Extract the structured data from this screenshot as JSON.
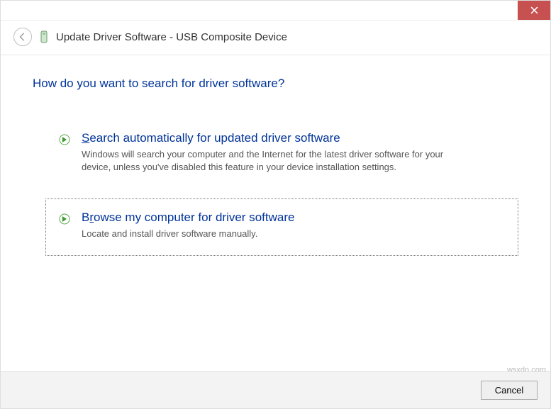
{
  "titlebar": {
    "close_tooltip": "Close"
  },
  "header": {
    "title": "Update Driver Software - USB Composite Device"
  },
  "main": {
    "question": "How do you want to search for driver software?",
    "options": [
      {
        "title_prefix": "S",
        "title_rest": "earch automatically for updated driver software",
        "description": "Windows will search your computer and the Internet for the latest driver software for your device, unless you've disabled this feature in your device installation settings."
      },
      {
        "title_prefix": "B",
        "title_mid": "r",
        "title_rest": "owse my computer for driver software",
        "description": "Locate and install driver software manually."
      }
    ]
  },
  "footer": {
    "cancel_label": "Cancel"
  },
  "watermark": "wsxdn.com"
}
